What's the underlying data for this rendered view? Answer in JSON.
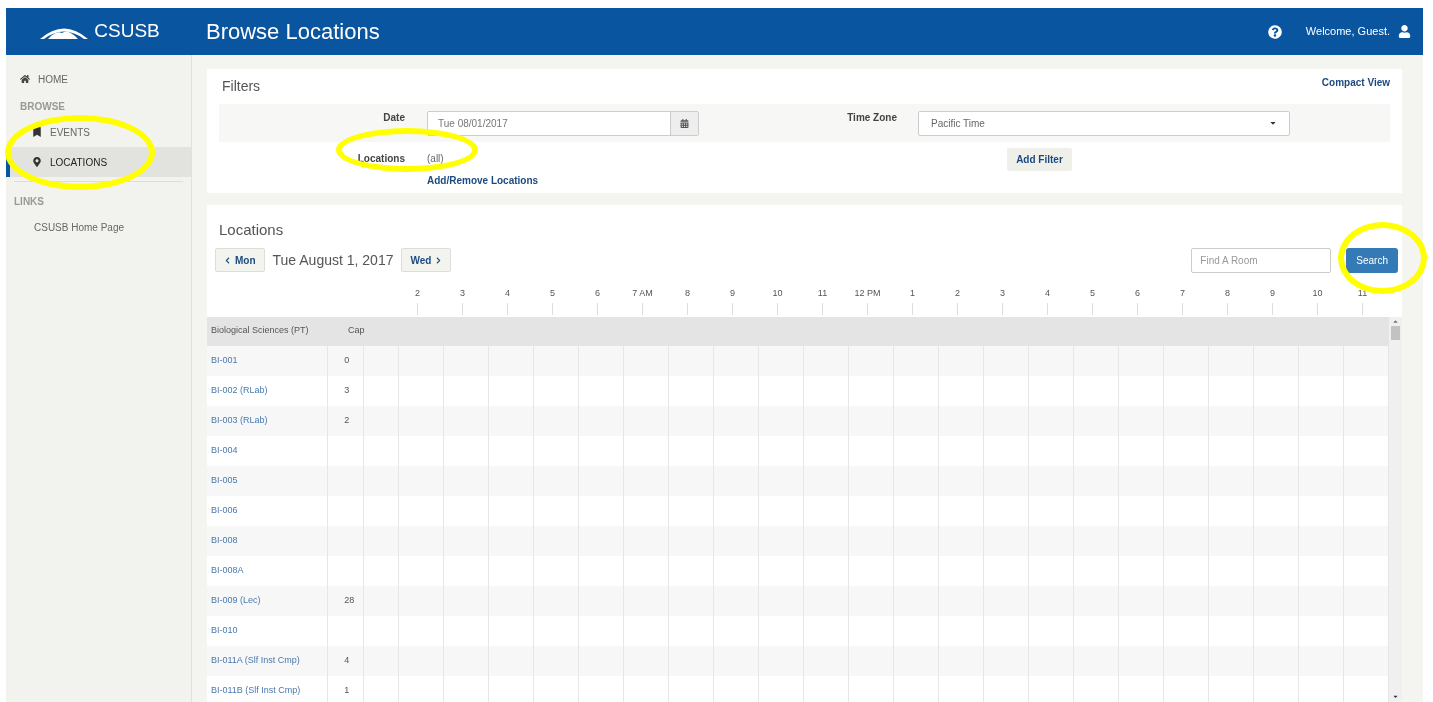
{
  "header": {
    "logo": "CSUSB",
    "title": "Browse Locations",
    "welcome": "Welcome, Guest."
  },
  "sidebar": {
    "home": {
      "label": "HOME",
      "selected": false
    },
    "sections": [
      {
        "heading": "BROWSE",
        "items": [
          {
            "kind": "icon",
            "label": "EVENTS",
            "selected": false
          },
          {
            "kind": "icon",
            "label": "LOCATIONS",
            "selected": true
          }
        ]
      },
      {
        "heading": "LINKS",
        "items": [
          {
            "kind": "plain",
            "label": "CSUSB Home Page",
            "selected": false
          }
        ]
      }
    ]
  },
  "filters": {
    "title": "Filters",
    "compact_view": "Compact View",
    "date": {
      "label": "Date",
      "value": "Tue 08/01/2017"
    },
    "time_zone": {
      "label": "Time Zone",
      "value": "Pacific Time"
    },
    "locations": {
      "label": "Locations",
      "value": "(all)",
      "link": "Add/Remove Locations"
    },
    "add_filter": "Add Filter"
  },
  "locations": {
    "title": "Locations",
    "prev": "Mon",
    "date": "Tue August 1, 2017",
    "next": "Wed",
    "search_placeholder": "Find A Room",
    "search_button": "Search",
    "hours": [
      "2",
      "3",
      "4",
      "5",
      "6",
      "7 AM",
      "8",
      "9",
      "10",
      "11",
      "12 PM",
      "1",
      "2",
      "3",
      "4",
      "5",
      "6",
      "7",
      "8",
      "9",
      "10",
      "11"
    ],
    "columns": [
      "Biological Sciences (PT)",
      "Cap"
    ],
    "rows": [
      {
        "name": "BI-001",
        "cap": "0"
      },
      {
        "name": "BI-002 (RLab)",
        "cap": "3"
      },
      {
        "name": "BI-003 (RLab)",
        "cap": "2"
      },
      {
        "name": "BI-004"
      },
      {
        "name": "BI-005"
      },
      {
        "name": "BI-006"
      },
      {
        "name": "BI-008"
      },
      {
        "name": "BI-008A"
      },
      {
        "name": "BI-009 (Lec)",
        "cap": "28"
      },
      {
        "name": "BI-010"
      },
      {
        "name": "BI-011A (Slf Inst Cmp)",
        "cap": "4"
      },
      {
        "name": "BI-011B (Slf Inst Cmp)",
        "cap": "1"
      }
    ]
  }
}
